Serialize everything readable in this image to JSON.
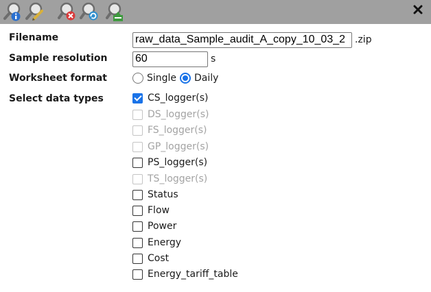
{
  "toolbar": {
    "icons": [
      {
        "name": "info-search-icon"
      },
      {
        "name": "edit-search-icon"
      },
      {
        "name": "delete-search-icon"
      },
      {
        "name": "refresh-search-icon"
      },
      {
        "name": "export-search-icon"
      }
    ],
    "close_icon": "close-icon"
  },
  "form": {
    "filename": {
      "label": "Filename",
      "value": "raw_data_Sample_audit_A_copy_10_03_2",
      "suffix": ".zip"
    },
    "resolution": {
      "label": "Sample resolution",
      "value": "60",
      "unit": "s"
    },
    "worksheet": {
      "label": "Worksheet format",
      "options": [
        {
          "label": "Single",
          "checked": false
        },
        {
          "label": "Daily",
          "checked": true
        }
      ]
    },
    "data_types": {
      "label": "Select data types",
      "items": [
        {
          "label": "CS_logger(s)",
          "checked": true,
          "disabled": false
        },
        {
          "label": "DS_logger(s)",
          "checked": false,
          "disabled": true
        },
        {
          "label": "FS_logger(s)",
          "checked": false,
          "disabled": true
        },
        {
          "label": "GP_logger(s)",
          "checked": false,
          "disabled": true
        },
        {
          "label": "PS_logger(s)",
          "checked": false,
          "disabled": false
        },
        {
          "label": "TS_logger(s)",
          "checked": false,
          "disabled": true
        },
        {
          "label": "Status",
          "checked": false,
          "disabled": false
        },
        {
          "label": "Flow",
          "checked": false,
          "disabled": false
        },
        {
          "label": "Power",
          "checked": false,
          "disabled": false
        },
        {
          "label": "Energy",
          "checked": false,
          "disabled": false
        },
        {
          "label": "Cost",
          "checked": false,
          "disabled": false
        },
        {
          "label": "Energy_tariff_table",
          "checked": false,
          "disabled": false
        }
      ]
    }
  },
  "colors": {
    "toolbar_bg": "#a0a0a0",
    "accent": "#1a73e8",
    "disabled_text": "#a3a3a3"
  }
}
